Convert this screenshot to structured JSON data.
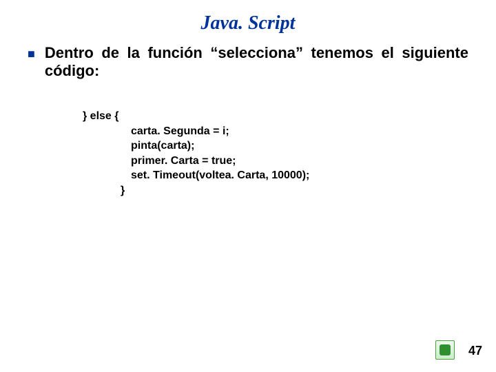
{
  "title": "Java. Script",
  "bullet_text": "Dentro de la función “selecciona” tenemos el siguiente código:",
  "code": {
    "open": "} else {",
    "lines": [
      "carta. Segunda = i;",
      "pinta(carta);",
      "primer. Carta = true;",
      "set. Timeout(voltea. Carta, 10000);"
    ],
    "close": "}"
  },
  "page_number": "47"
}
